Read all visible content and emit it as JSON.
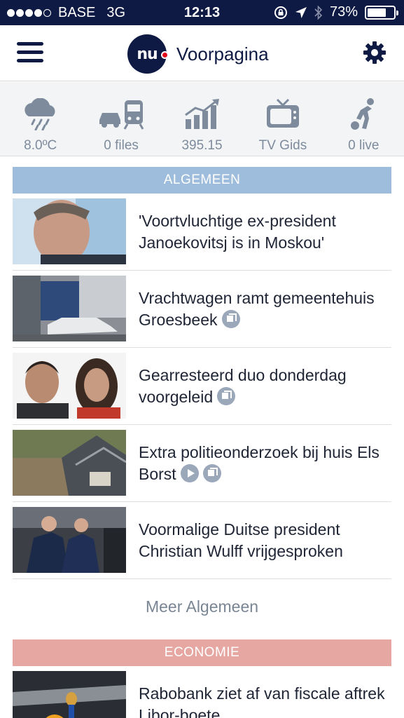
{
  "status": {
    "carrier": "BASE",
    "network": "3G",
    "time": "12:13",
    "battery": "73%",
    "battery_level": 0.73
  },
  "navbar": {
    "logo_text": "nu",
    "title": "Voorpagina",
    "menu_icon": "hamburger-icon",
    "settings_icon": "gear-icon"
  },
  "quickbar": [
    {
      "icon": "weather-rain-icon",
      "label": "8.0ºC"
    },
    {
      "icon": "traffic-icon",
      "label": "0 files"
    },
    {
      "icon": "stock-chart-icon",
      "label": "395.15"
    },
    {
      "icon": "tv-icon",
      "label": "TV Gids"
    },
    {
      "icon": "soccer-player-icon",
      "label": "0 live"
    }
  ],
  "sections": [
    {
      "title": "ALGEMEEN",
      "color": "#9ebddc",
      "articles": [
        {
          "headline": "'Voortvluchtige ex-president Janoekovitsj is in Moskou'",
          "badges": []
        },
        {
          "headline": "Vrachtwagen ramt gemeentehuis Groesbeek",
          "badges": [
            "gallery"
          ]
        },
        {
          "headline": "Gearresteerd duo donderdag voorgeleid",
          "badges": [
            "gallery"
          ]
        },
        {
          "headline": "Extra politieonderzoek bij huis Els Borst",
          "badges": [
            "video",
            "gallery"
          ]
        },
        {
          "headline": "Voormalige Duitse president Christian Wulff vrijgesproken",
          "badges": []
        }
      ],
      "more_label": "Meer Algemeen"
    },
    {
      "title": "ECONOMIE",
      "color": "#e6a7a2",
      "articles": [
        {
          "headline": "Rabobank ziet af van fiscale aftrek Libor-boete",
          "badges": []
        }
      ]
    }
  ]
}
